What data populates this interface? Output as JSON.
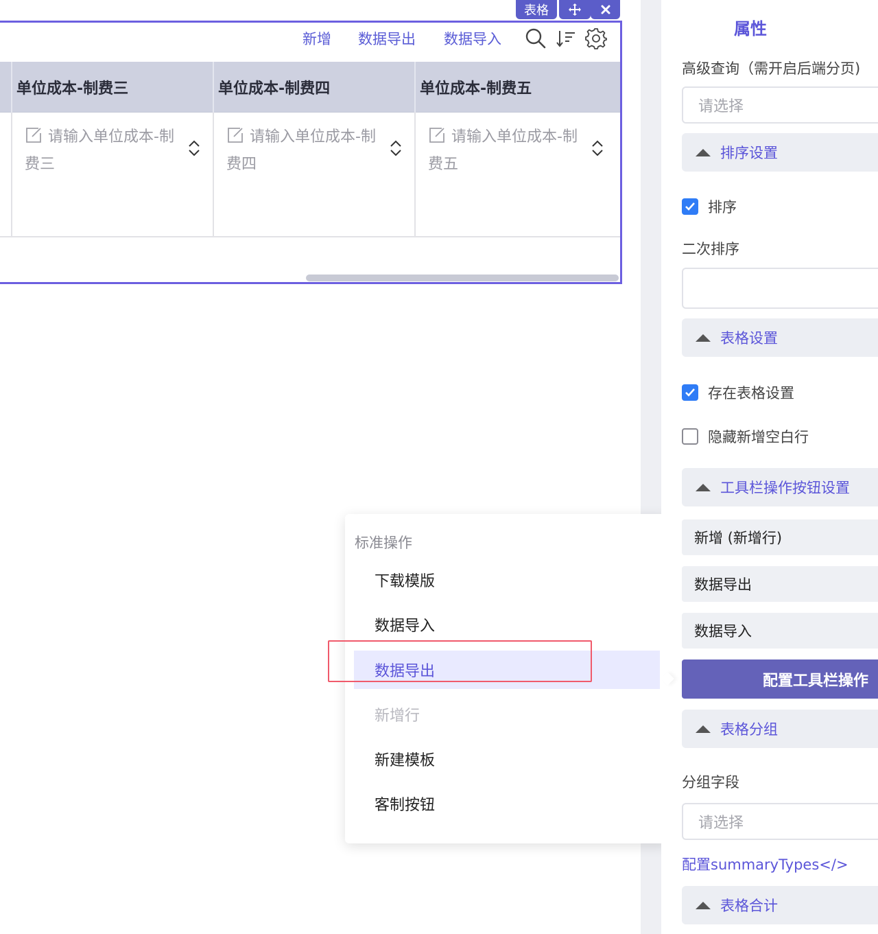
{
  "widget": {
    "tag_label": "表格",
    "toolbar": {
      "add": "新增",
      "export": "数据导出",
      "import": "数据导入"
    },
    "columns": [
      "单位成本-制费三",
      "单位成本-制费四",
      "单位成本-制费五"
    ],
    "placeholders": [
      "请输入单位成本-制费三",
      "请输入单位成本-制费四",
      "请输入单位成本-制费五"
    ]
  },
  "dropdown": {
    "group_label": "标准操作",
    "items": [
      "下载模版",
      "数据导入",
      "数据导出",
      "新增行",
      "新建模板",
      "客制按钮"
    ],
    "active_item": "数据导出",
    "disabled_item": "新增行"
  },
  "panel": {
    "title": "属性",
    "advanced_query_label": "高级查询（需开启后端分页)",
    "advanced_query_placeholder": "请选择",
    "sort_section": "排序设置",
    "sort_checkbox": "排序",
    "secondary_sort_label": "二次排序",
    "table_section": "表格设置",
    "exist_table_setting": "存在表格设置",
    "hide_blank_row": "隐藏新增空白行",
    "toolbar_section": "工具栏操作按钮设置",
    "toolbar_buttons": [
      "新增 (新增行)",
      "数据导出",
      "数据导入"
    ],
    "configure_toolbar_button": "配置工具栏操作",
    "group_section": "表格分组",
    "group_field_label": "分组字段",
    "group_field_placeholder": "请选择",
    "summary_link": "配置summaryTypes</>",
    "total_section": "表格合计"
  },
  "colors": {
    "accent": "#5b55d9",
    "primary_button": "#6462b9",
    "widget_border": "#6c5fe0",
    "highlight": "#f05a6b",
    "checkbox": "#2f7cf6"
  }
}
